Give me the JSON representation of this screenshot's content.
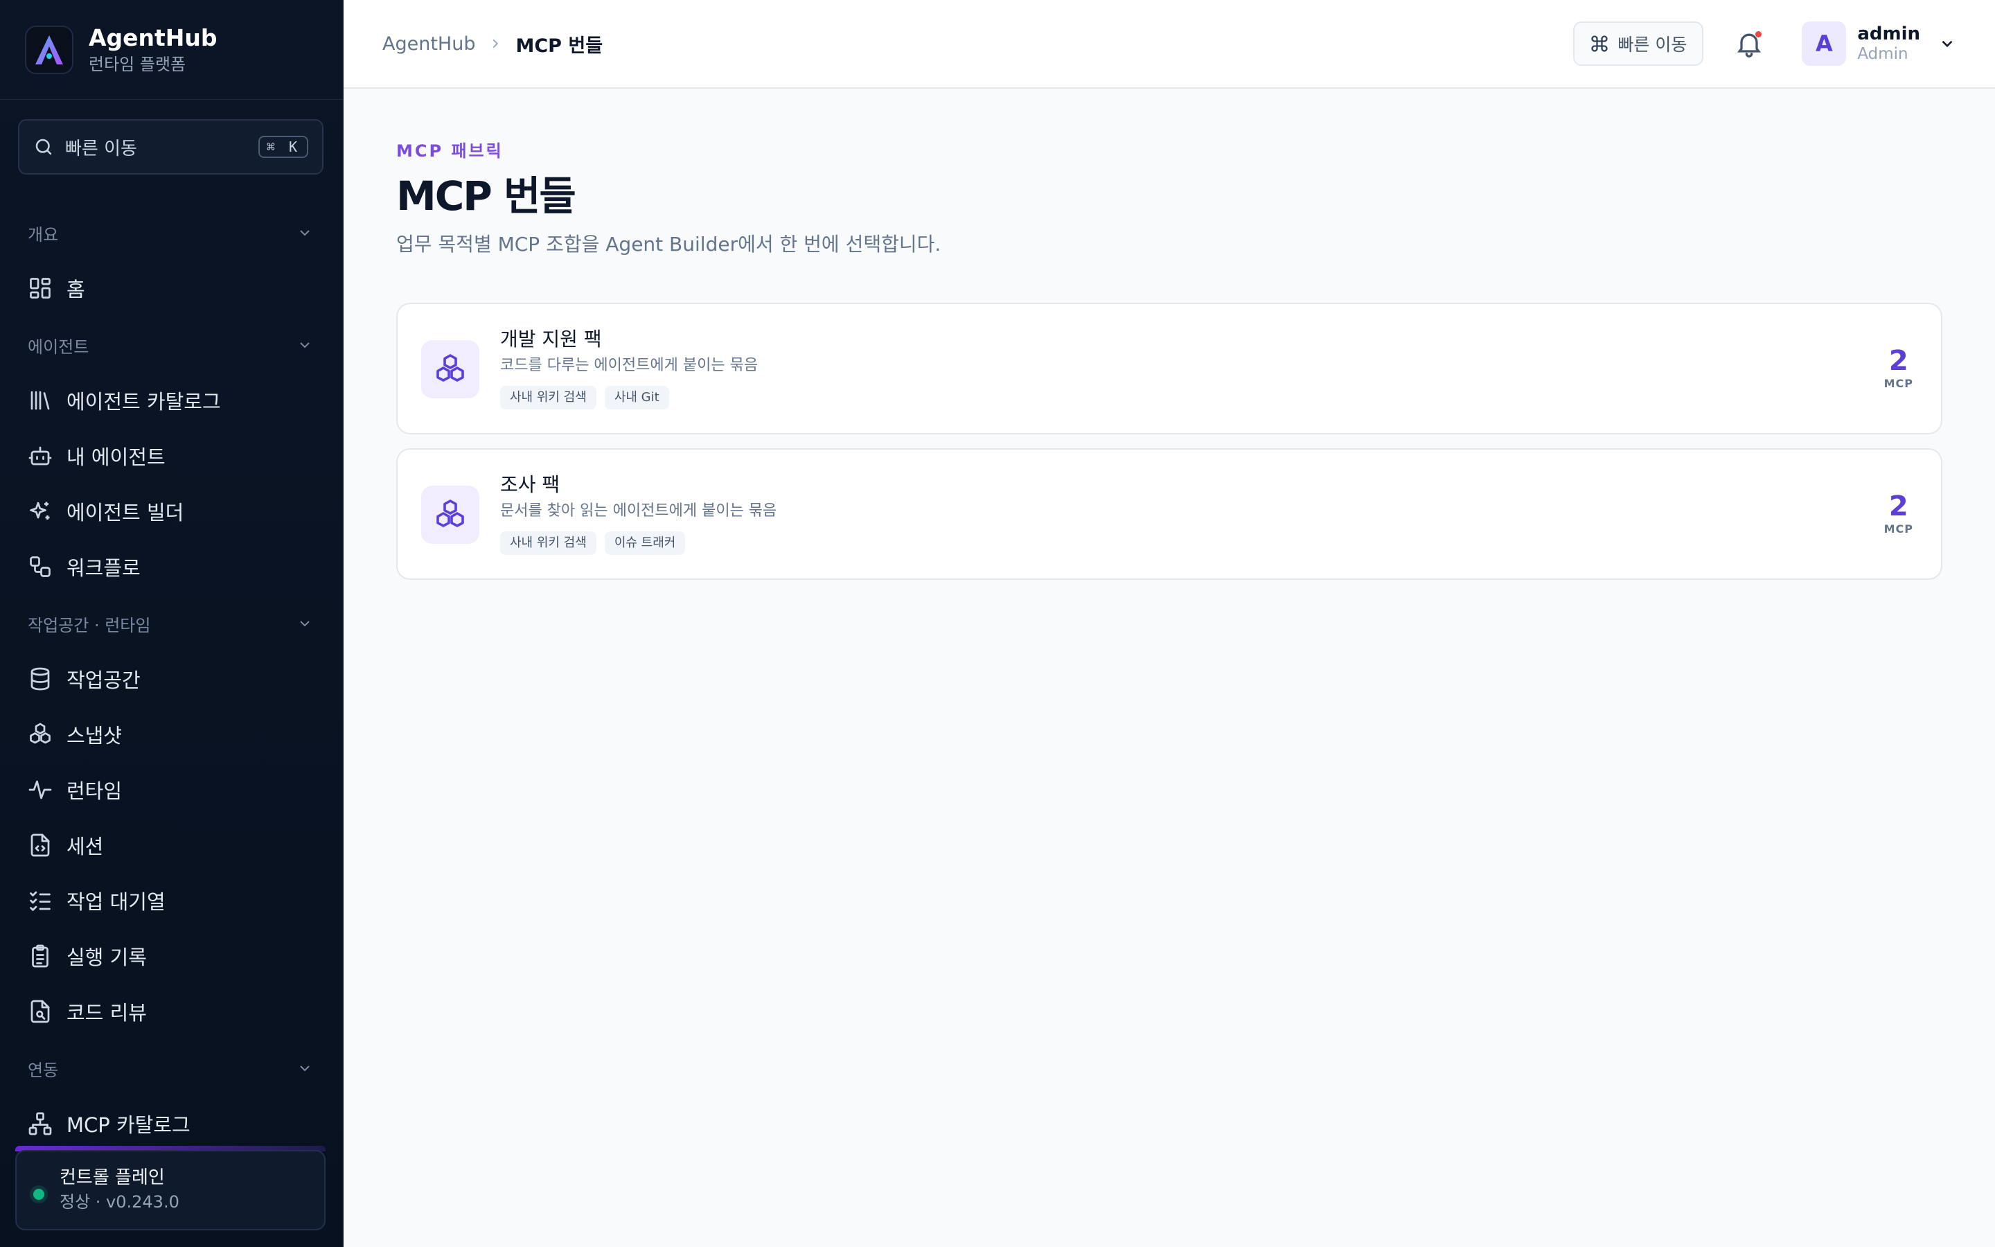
{
  "brand": {
    "name": "AgentHub",
    "subtitle": "런타임 플랫폼"
  },
  "sidebar": {
    "search": {
      "label": "빠른 이동",
      "shortcut": "⌘ K"
    },
    "sections": [
      {
        "label": "개요",
        "items": [
          {
            "label": "홈",
            "icon": "home-grid-icon"
          }
        ]
      },
      {
        "label": "에이전트",
        "items": [
          {
            "label": "에이전트 카탈로그",
            "icon": "library-icon"
          },
          {
            "label": "내 에이전트",
            "icon": "bot-icon"
          },
          {
            "label": "에이전트 빌더",
            "icon": "sparkles-icon"
          },
          {
            "label": "워크플로",
            "icon": "workflow-icon"
          }
        ]
      },
      {
        "label": "작업공간 · 런타임",
        "items": [
          {
            "label": "작업공간",
            "icon": "database-icon"
          },
          {
            "label": "스냅샷",
            "icon": "boxes-icon"
          },
          {
            "label": "런타임",
            "icon": "activity-icon"
          },
          {
            "label": "세션",
            "icon": "file-code-icon"
          },
          {
            "label": "작업 대기열",
            "icon": "list-checks-icon"
          },
          {
            "label": "실행 기록",
            "icon": "clipboard-icon"
          },
          {
            "label": "코드 리뷰",
            "icon": "file-search-icon"
          }
        ]
      },
      {
        "label": "연동",
        "items": [
          {
            "label": "MCP 카탈로그",
            "icon": "network-icon"
          }
        ]
      }
    ],
    "control_plane": {
      "title": "컨트롤 플레인",
      "status": "정상 · v0.243.0",
      "status_color": "#10b981"
    }
  },
  "header": {
    "breadcrumb": {
      "home": "AgentHub",
      "current": "MCP 번들"
    },
    "quick_nav": "빠른 이동",
    "user": {
      "initial": "A",
      "name": "admin",
      "role": "Admin"
    }
  },
  "main": {
    "eyebrow": "MCP 패브릭",
    "title": "MCP 번들",
    "subtitle": "업무 목적별 MCP 조합을 Agent Builder에서 한 번에 선택합니다.",
    "bundles": [
      {
        "title": "개발 지원 팩",
        "description": "코드를 다루는 에이전트에게 붙이는 묶음",
        "tags": [
          "사내 위키 검색",
          "사내 Git"
        ],
        "count": "2",
        "unit": "MCP"
      },
      {
        "title": "조사 팩",
        "description": "문서를 찾아 읽는 에이전트에게 붙이는 묶음",
        "tags": [
          "사내 위키 검색",
          "이슈 트래커"
        ],
        "count": "2",
        "unit": "MCP"
      }
    ]
  },
  "colors": {
    "accent": "#5b3fd6",
    "sidebar_bg": "#0b1526",
    "page_bg": "#f8fafc"
  }
}
